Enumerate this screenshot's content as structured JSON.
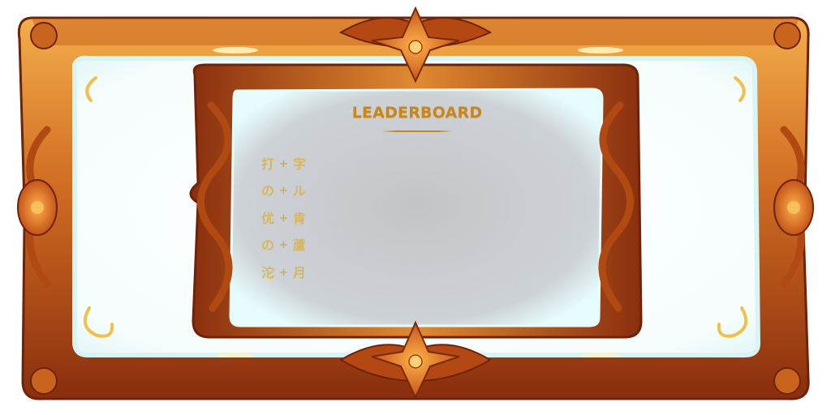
{
  "leaderboard": {
    "title": "LEADERBOARD",
    "rows": [
      {
        "left": "打",
        "sep": "+",
        "right": "字"
      },
      {
        "left": "の",
        "sep": "+",
        "right": "ル"
      },
      {
        "left": "优",
        "sep": "+",
        "right": "肯"
      },
      {
        "left": "の",
        "sep": "+",
        "right": "蘆"
      },
      {
        "left": "沱",
        "sep": "+",
        "right": "月"
      }
    ]
  },
  "colors": {
    "frame_dark": "#8a2f0e",
    "frame_mid": "#c8641e",
    "frame_light": "#f0a23a",
    "panel_fill": "#c8c8cc",
    "panel_glow": "#dff6f6",
    "title_gold": "#c9861c",
    "entry_gold": "#e2b53a"
  },
  "icons": {
    "top_ornament": "flower-ornament-icon",
    "bottom_ornament": "flower-ornament-icon",
    "side_ornament": "scroll-flourish-icon"
  }
}
